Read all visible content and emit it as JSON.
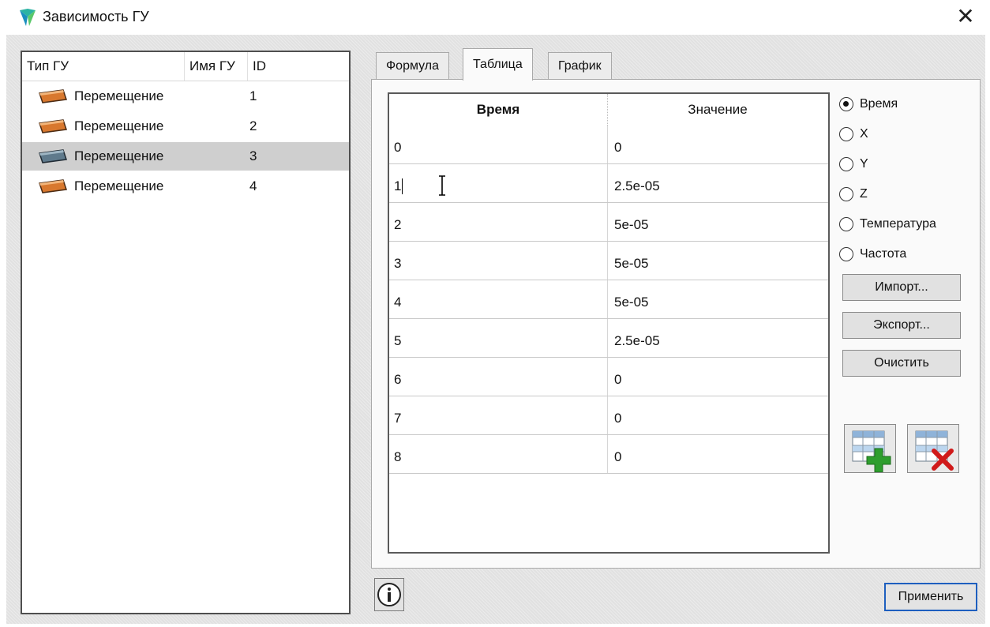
{
  "window": {
    "title": "Зависимость ГУ",
    "close_glyph": "✕",
    "icon": "app-logo-icon"
  },
  "list": {
    "headers": [
      "Тип ГУ",
      "Имя ГУ",
      "ID"
    ],
    "rows": [
      {
        "type": "Перемещение",
        "name": "",
        "id": "1",
        "icon": "displacement-icon",
        "selected": false
      },
      {
        "type": "Перемещение",
        "name": "",
        "id": "2",
        "icon": "displacement-icon",
        "selected": false
      },
      {
        "type": "Перемещение",
        "name": "",
        "id": "3",
        "icon": "displacement-icon",
        "selected": true
      },
      {
        "type": "Перемещение",
        "name": "",
        "id": "4",
        "icon": "displacement-icon",
        "selected": false
      }
    ]
  },
  "tabs": [
    {
      "label": "Формула",
      "active": false
    },
    {
      "label": "Таблица",
      "active": true
    },
    {
      "label": "График",
      "active": false
    }
  ],
  "table": {
    "headers": [
      "Время",
      "Значение"
    ],
    "rows": [
      [
        "0",
        "0"
      ],
      [
        "1",
        "2.5e-05"
      ],
      [
        "2",
        "5e-05"
      ],
      [
        "3",
        "5e-05"
      ],
      [
        "4",
        "5e-05"
      ],
      [
        "5",
        "2.5e-05"
      ],
      [
        "6",
        "0"
      ],
      [
        "7",
        "0"
      ],
      [
        "8",
        "0"
      ]
    ],
    "editing_row": 1
  },
  "radios": [
    {
      "label": "Время",
      "checked": true
    },
    {
      "label": "X",
      "checked": false
    },
    {
      "label": "Y",
      "checked": false
    },
    {
      "label": "Z",
      "checked": false
    },
    {
      "label": "Температура",
      "checked": false
    },
    {
      "label": "Частота",
      "checked": false
    }
  ],
  "buttons": {
    "import": "Импорт...",
    "export": "Экспорт...",
    "clear": "Очистить",
    "add_row_icon": "add-row-icon",
    "delete_row_icon": "delete-row-icon",
    "info_icon": "info-icon",
    "apply": "Применить"
  },
  "colors": {
    "selected_row": "#cfcfcf",
    "apply_border": "#1e5fbf",
    "add_green": "#2e9e2e",
    "delete_red": "#d01a1a"
  }
}
